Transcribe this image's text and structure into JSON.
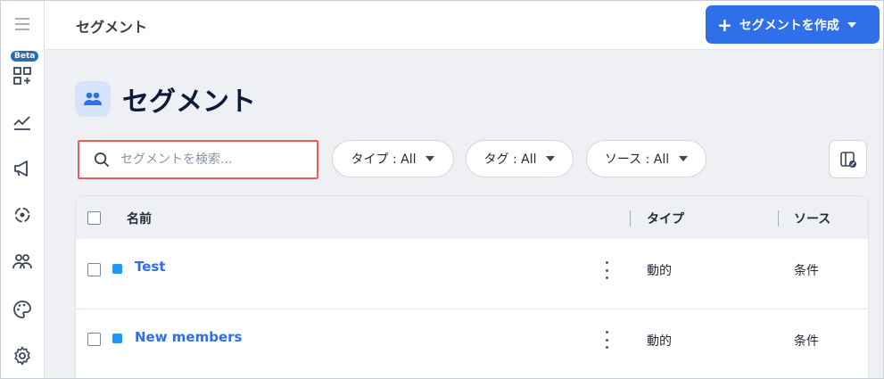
{
  "topbar": {
    "title": "セグメント",
    "create_button": {
      "icon": "+",
      "label": "セグメントを作成"
    }
  },
  "sidebar": {
    "beta_badge": "Beta",
    "items": [
      "menu-icon",
      "apps-add-icon",
      "analytics-icon",
      "megaphone-icon",
      "automation-icon",
      "people-icon",
      "palette-icon",
      "gear-icon"
    ]
  },
  "page": {
    "title": "セグメント"
  },
  "search": {
    "placeholder": "セグメントを検索...",
    "value": ""
  },
  "filters": [
    {
      "label": "タイプ : All"
    },
    {
      "label": "タグ : All"
    },
    {
      "label": "ソース : All"
    }
  ],
  "table": {
    "columns": {
      "name": "名前",
      "type": "タイプ",
      "source": "ソース"
    },
    "rows": [
      {
        "name": "Test",
        "type": "動的",
        "source": "条件"
      },
      {
        "name": "New members",
        "type": "動的",
        "source": "条件"
      }
    ]
  },
  "colors": {
    "accent": "#2f6fea",
    "swatch": "#2196f3",
    "highlight": "#e85c5c"
  }
}
